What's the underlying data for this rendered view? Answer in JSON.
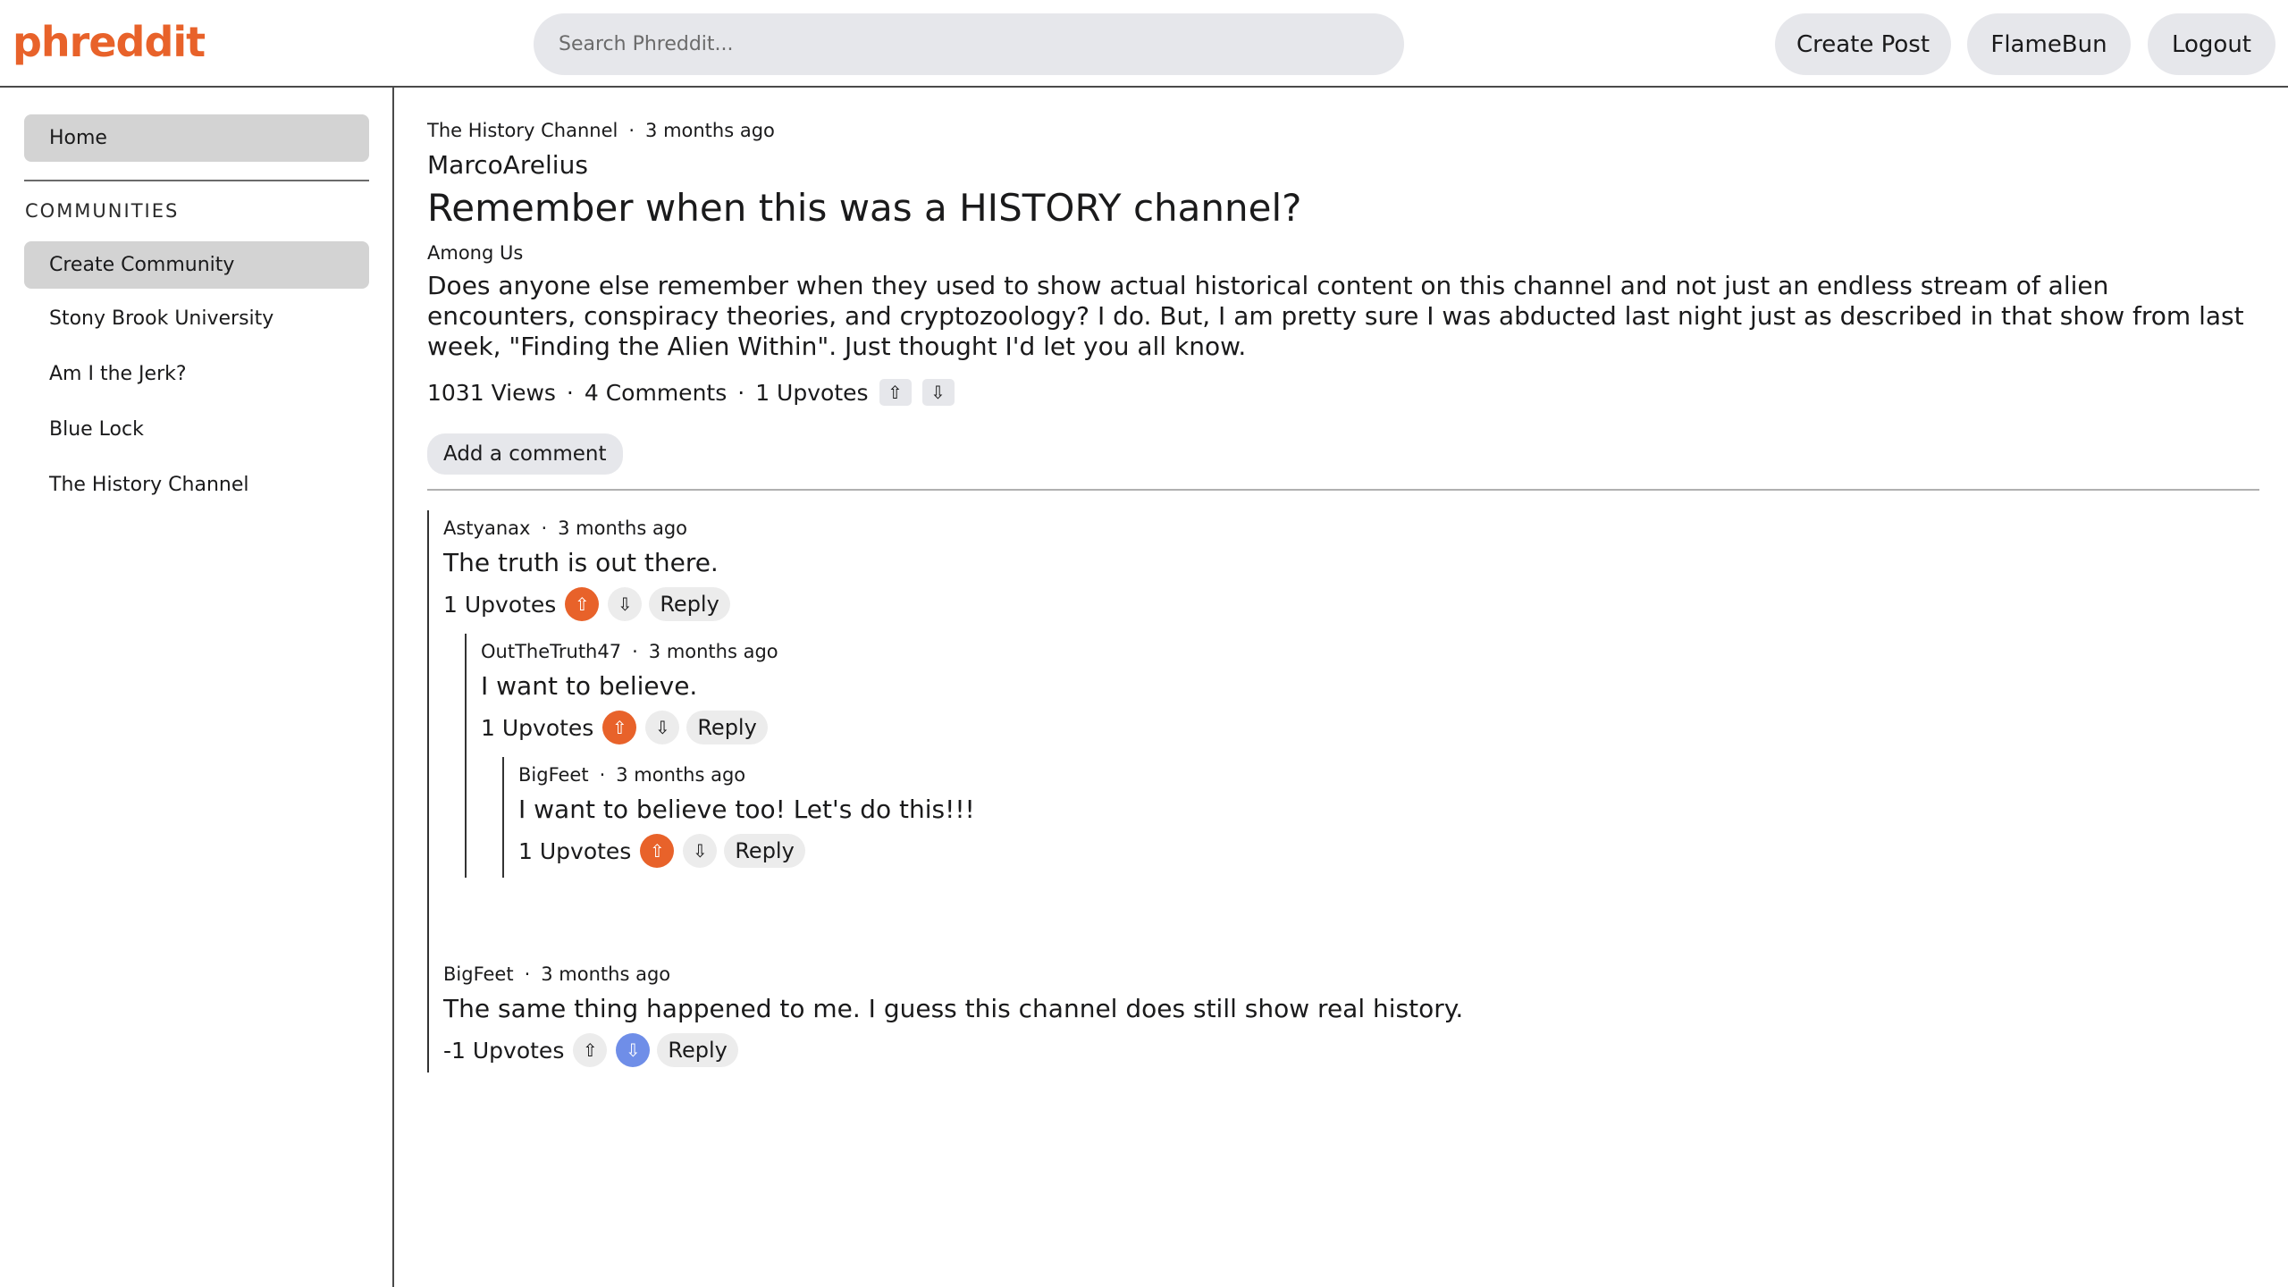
{
  "header": {
    "logo": "phreddit",
    "search_placeholder": "Search Phreddit...",
    "create_post": "Create Post",
    "username": "FlameBun",
    "logout": "Logout"
  },
  "sidebar": {
    "home": "Home",
    "communities_heading": "COMMUNITIES",
    "create_community": "Create Community",
    "communities": [
      "Stony Brook University",
      "Am I the Jerk?",
      "Blue Lock",
      "The History Channel"
    ]
  },
  "post": {
    "community": "The History Channel",
    "time": "3 months ago",
    "author": "MarcoArelius",
    "title": "Remember when this was a HISTORY channel?",
    "flair": "Among Us",
    "body": "Does anyone else remember when they used to show actual historical content on this channel and not just an endless stream of alien encounters, conspiracy theories, and cryptozoology? I do. But, I am pretty sure I was abducted last night just as described in that show from last week, \"Finding the Alien Within\". Just thought I'd let you all know.",
    "views": "1031 Views",
    "comments": "4 Comments",
    "upvotes": "1 Upvotes",
    "up_icon": "⇧",
    "down_icon": "⇩",
    "add_comment": "Add a comment"
  },
  "comments": [
    {
      "author": "Astyanax",
      "time": "3 months ago",
      "text": "The truth is out there.",
      "votes": "1 Upvotes",
      "vote_state": "up",
      "reply": "Reply"
    },
    {
      "author": "OutTheTruth47",
      "time": "3 months ago",
      "text": "I want to believe.",
      "votes": "1 Upvotes",
      "vote_state": "up",
      "reply": "Reply"
    },
    {
      "author": "BigFeet",
      "time": "3 months ago",
      "text": "I want to believe too! Let's do this!!!",
      "votes": "1 Upvotes",
      "vote_state": "up",
      "reply": "Reply"
    },
    {
      "author": "BigFeet",
      "time": "3 months ago",
      "text": "The same thing happened to me. I guess this channel does still show real history.",
      "votes": "-1 Upvotes",
      "vote_state": "down",
      "reply": "Reply"
    }
  ],
  "separator": "·",
  "colors": {
    "accent": "#e8622a",
    "downvote": "#6f8ee8",
    "button_bg": "#e6e7eb",
    "sidebar_active": "#d3d3d3"
  }
}
